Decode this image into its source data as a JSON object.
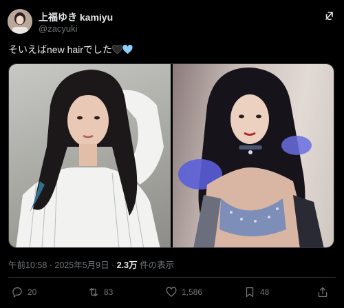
{
  "author": {
    "display_name": "上福ゆき kamiyu",
    "handle": "@zacyuki"
  },
  "tweet": {
    "text": "そいえばnew hairでした",
    "emojis": [
      "black-heart",
      "blue-heart"
    ]
  },
  "meta": {
    "timestamp": "午前10:58 · 2025年5月9日 · ",
    "views_count": "2.3万",
    "views_label": " 件の表示"
  },
  "actions": {
    "replies": "20",
    "reposts": "83",
    "likes": "1,586",
    "bookmarks": "48"
  },
  "icons": {
    "reply": "reply-icon",
    "repost": "repost-icon",
    "like": "like-icon",
    "bookmark": "bookmark-icon",
    "share": "share-icon",
    "grok": "grok-icon"
  },
  "colors": {
    "background": "#000000",
    "text": "#e7e9ea",
    "secondary": "#71767b",
    "blue_heart": "#8ecdf8"
  }
}
